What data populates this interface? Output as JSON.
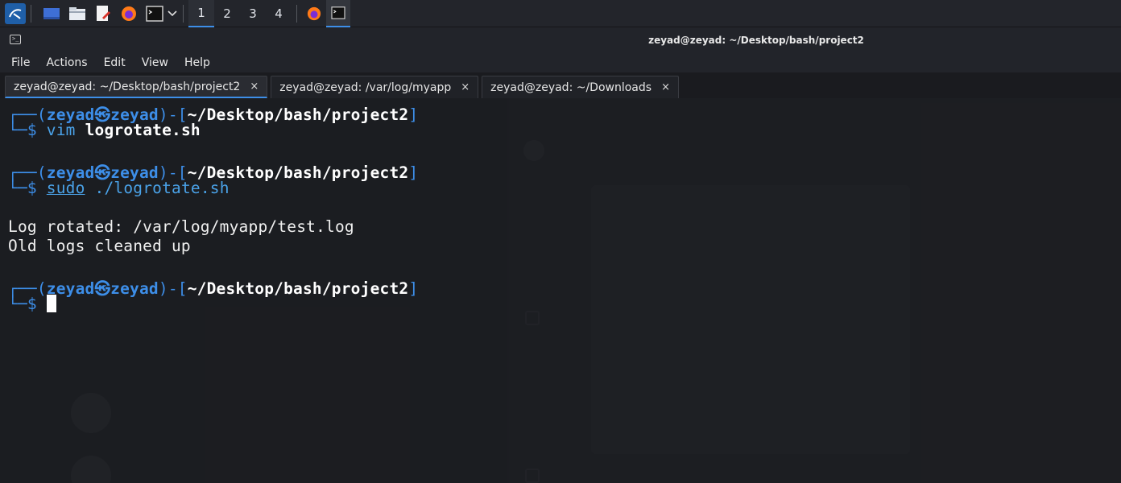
{
  "taskbar": {
    "workspaces": [
      "1",
      "2",
      "3",
      "4"
    ],
    "active_workspace": "1",
    "accent": "#3d8ee8"
  },
  "window": {
    "title": "zeyad@zeyad: ~/Desktop/bash/project2"
  },
  "menu": [
    "File",
    "Actions",
    "Edit",
    "View",
    "Help"
  ],
  "tabs": [
    {
      "label": "zeyad@zeyad: ~/Desktop/bash/project2",
      "close": "×",
      "active": true
    },
    {
      "label": "zeyad@zeyad: /var/log/myapp",
      "close": "×",
      "active": false
    },
    {
      "label": "zeyad@zeyad: ~/Downloads",
      "close": "×",
      "active": false
    }
  ],
  "prompt": {
    "open": "┌──(",
    "user": "zeyad",
    "skull": "㉿",
    "host": "zeyad",
    "mid": ")-[",
    "path": "~/Desktop/bash/project2",
    "close": "]",
    "second": "└─",
    "dollar": "$"
  },
  "session": {
    "cmd1": {
      "cmd": "vim",
      "arg": "logrotate.sh"
    },
    "cmd2": {
      "cmd": "sudo",
      "arg": "./logrotate.sh"
    },
    "output": [
      "Log rotated: /var/log/myapp/test.log",
      "Old logs cleaned up"
    ]
  },
  "colors": {
    "prompt_blue": "#3d8ee8",
    "terminal_bg": "#1a1b1f",
    "text": "#f0f0f0"
  }
}
